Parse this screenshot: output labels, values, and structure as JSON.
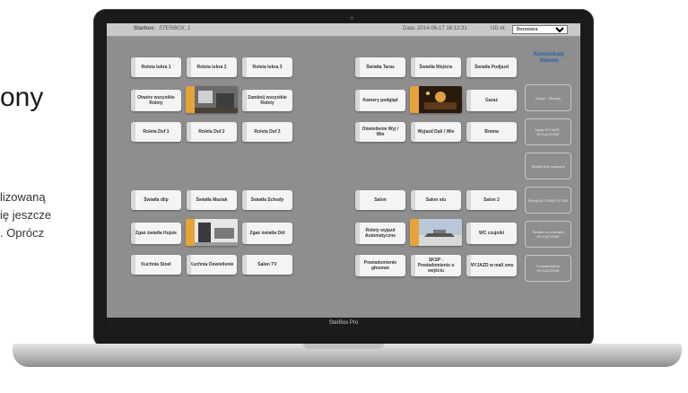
{
  "side_text": {
    "title": "ony",
    "lines": [
      "lizowaną",
      "ię jeszcze",
      ". Oprócz"
    ]
  },
  "topbar": {
    "left_label": "Starbox:",
    "left_value": "STERBOX_1",
    "date": "Data: 2014-06-17 16:13:31",
    "user_label": "UD dr.",
    "select_value": "Bezowana"
  },
  "footer": "SterBox Pro",
  "colors": {
    "accent": "#e8a23a",
    "panel_title": "#2a5fa8",
    "screen_bg": "#8e8e8e"
  },
  "left_group1": {
    "row1": [
      "Roleta lobra 1",
      "Roleta lobra 2",
      "Roleta lobra 3"
    ],
    "row2": [
      "Otwórz wszystkie Rolety",
      "Zamknij wszystkie Rolety"
    ],
    "row3": [
      "Roleta Duf 1",
      "Roleta Duf 2",
      "Roleta Duf 3"
    ]
  },
  "right_group1": {
    "row1": [
      "Światła Taras",
      "Światła Wejście",
      "Światła Podjazd"
    ],
    "row2": [
      "Kamery podgląd",
      "Garaż"
    ],
    "row3": [
      "Oświetlenie Wyj / Wie",
      "Wyjazd Dali / Wie",
      "Brama"
    ]
  },
  "left_group2": {
    "row1": [
      "Światła dlip",
      "Światła Maziak",
      "Światła Schody"
    ],
    "row2": [
      "Zgaś światła Hujsie",
      "Zgaś światła Dół"
    ],
    "row3": [
      "Kuchnia Stoel",
      "Kuchnia Oświetlenie",
      "Salon TV"
    ]
  },
  "right_group2": {
    "row1": [
      "Salon",
      "Salon stu",
      "Salon 2"
    ],
    "row2": [
      "Rolety wyjazd Automatyczne",
      "WC czujniki"
    ],
    "row3": [
      "Powiadomienie głosowe",
      "SKSP - Powiadomienie o wejściu",
      "WYJAZD w mall sms"
    ]
  },
  "panel": {
    "title": "Komunikaty Stanów",
    "items": [
      "Garaż - Otwarty",
      "Opcja WYJAZD - WYŁĄCZONE",
      "Światło jest zapalone",
      "Rolety AUTOMATYCZNE",
      "Światło na zewnątrz WYŁĄCZONE",
      "Powiadomienie WYŁĄCZONE"
    ]
  }
}
